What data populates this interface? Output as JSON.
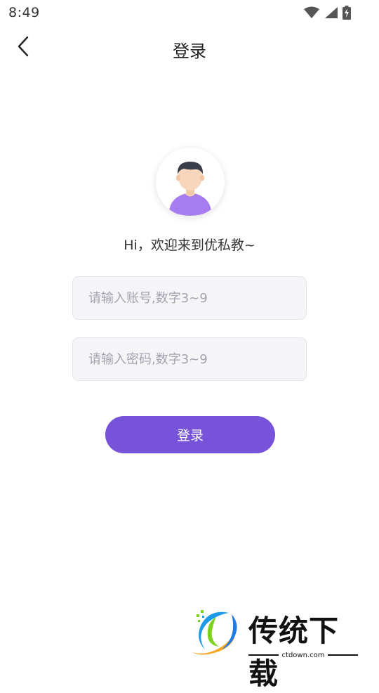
{
  "status_bar": {
    "time": "8:49"
  },
  "nav": {
    "title": "登录"
  },
  "greeting": "Hi，欢迎来到优私教~",
  "account_field": {
    "placeholder": "请输入账号,数字3~9",
    "value": ""
  },
  "password_field": {
    "placeholder": "请输入密码,数字3~9",
    "value": ""
  },
  "login_button": {
    "label": "登录"
  },
  "watermark": {
    "text": "传统下载",
    "url": "ctdown.com"
  },
  "colors": {
    "accent": "#7653d8",
    "input_bg": "#f5f5f8",
    "avatar_shirt": "#a77cf0"
  },
  "icons": [
    "wifi-icon",
    "signal-icon",
    "battery-charging-icon",
    "back-arrow-icon",
    "avatar-icon"
  ]
}
